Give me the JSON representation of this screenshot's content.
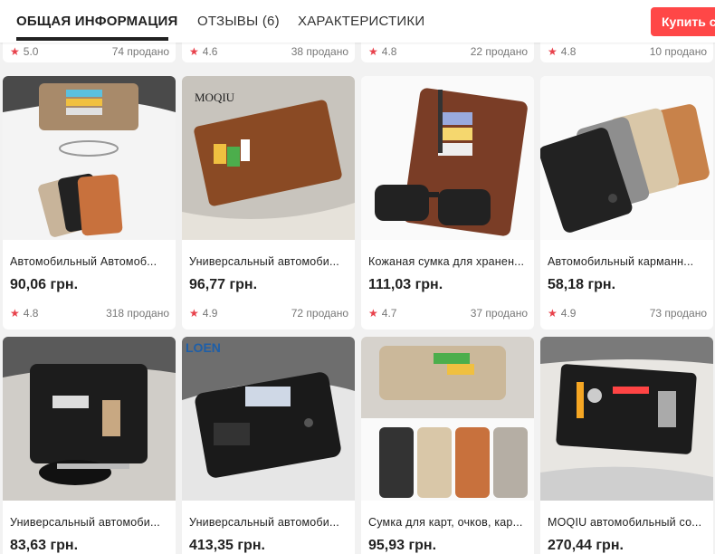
{
  "tabs": [
    {
      "label": "ОБЩАЯ ИНФОРМАЦИЯ",
      "active": true
    },
    {
      "label": "ОТЗЫВЫ (6)",
      "active": false
    },
    {
      "label": "ХАРАКТЕРИСТИКИ",
      "active": false
    }
  ],
  "buy_button": "Купить се",
  "colors": {
    "accent": "#ff4747",
    "star": "#e8424c"
  },
  "top_row": [
    {
      "rating": "5.0",
      "sold": "74 продано"
    },
    {
      "rating": "4.6",
      "sold": "38 продано"
    },
    {
      "rating": "4.8",
      "sold": "22 продано"
    },
    {
      "rating": "4.8",
      "sold": "10 продано"
    }
  ],
  "products_row1": [
    {
      "title": "Автомобильный Автомоб...",
      "price": "90,06 грн.",
      "rating": "4.8",
      "sold": "318 продано"
    },
    {
      "title": "Универсальный автомоби...",
      "price": "96,77 грн.",
      "rating": "4.9",
      "sold": "72 продано"
    },
    {
      "title": "Кожаная сумка для хранен...",
      "price": "111,03 грн.",
      "rating": "4.7",
      "sold": "37 продано"
    },
    {
      "title": "Автомобильный карманн...",
      "price": "58,18 грн.",
      "rating": "4.9",
      "sold": "73 продано"
    }
  ],
  "products_row2": [
    {
      "title": "Универсальный автомоби...",
      "price": "83,63 грн."
    },
    {
      "title": "Универсальный автомоби...",
      "price": "413,35 грн.",
      "logo": "LOEN"
    },
    {
      "title": "Сумка для карт, очков, кар...",
      "price": "95,93 грн."
    },
    {
      "title": "MOQIU автомобильный со...",
      "price": "270,44 грн."
    }
  ],
  "image_logos": {
    "moqiu": "MOQIU"
  },
  "star_glyph": "★"
}
